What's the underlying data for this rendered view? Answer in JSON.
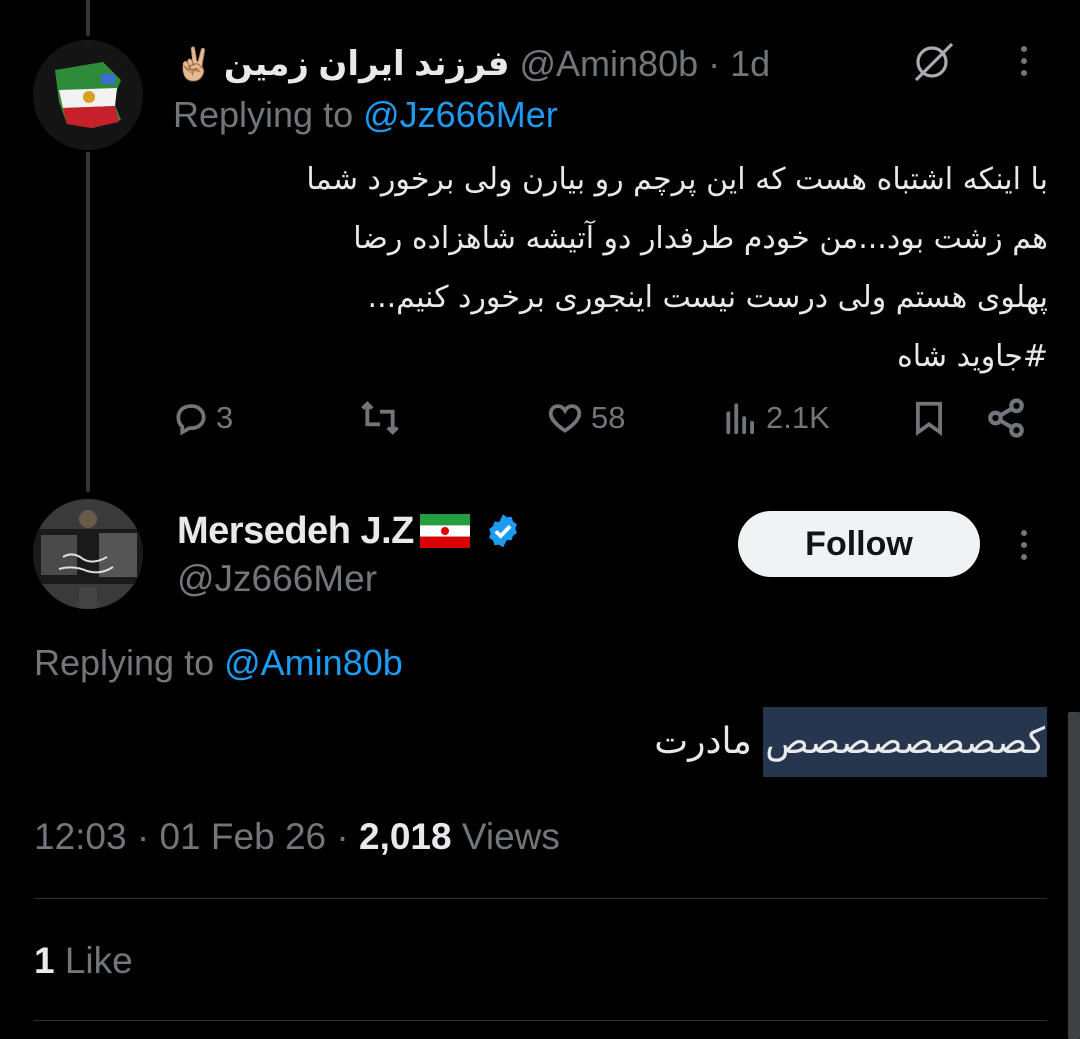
{
  "reply_tweet": {
    "display_name": "فرزند ایران زمین",
    "emoji": "✌🏼",
    "handle": "@Amin80b",
    "separator": "·",
    "time": "1d",
    "replying_prefix": "Replying to",
    "replying_handle": "@Jz666Mer",
    "text_lines": [
      "با اینکه اشتباه هست که این پرچم رو بیارن ولی برخورد شما",
      "هم زشت بود...من خودم طرفدار دو آتیشه شاهزاده رضا",
      "پهلوی هستم ولی درست نیست اینجوری برخورد کنیم...",
      "#جاوید شاه"
    ],
    "actions": {
      "replies": "3",
      "retweets": "",
      "likes": "58",
      "views": "2.1K"
    }
  },
  "main_tweet": {
    "display_name": "Mersedeh J.Z",
    "flag": "🇮🇷",
    "verified": true,
    "handle": "@Jz666Mer",
    "follow_label": "Follow",
    "replying_prefix": "Replying to",
    "replying_handle": "@Amin80b",
    "text_highlighted": "کصصصصصصصص",
    "text_rest": " مادرت",
    "timestamp": "12:03 · 01 Feb 26",
    "timestamp_sep": " · ",
    "views_count": "2,018",
    "views_label": " Views",
    "likes_count": "1",
    "likes_label": " Like"
  },
  "colors": {
    "background": "#000000",
    "text": "#e7e9ea",
    "secondary": "#71767b",
    "accent": "#1d9bf0",
    "highlight": "#26364e"
  },
  "icons": [
    "grok-icon",
    "more-icon",
    "reply-icon",
    "retweet-icon",
    "like-icon",
    "views-icon",
    "bookmark-icon",
    "share-icon",
    "verified-badge-icon"
  ]
}
